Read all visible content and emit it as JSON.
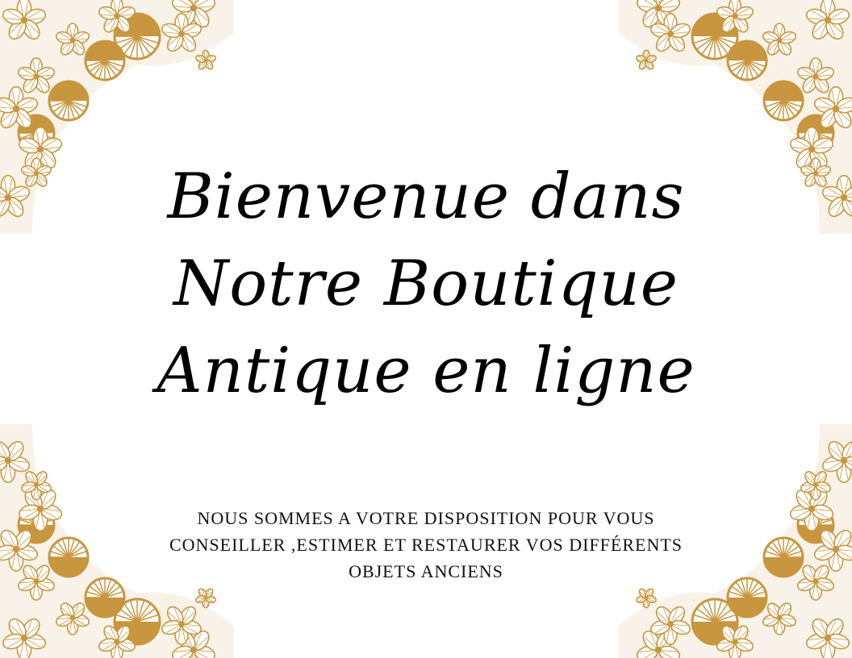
{
  "colors": {
    "lace": "#c8963e",
    "text": "#000000",
    "background": "#ffffff"
  },
  "title": {
    "lines": [
      "Bienvenue dans",
      "Notre Boutique",
      "Antique en ligne"
    ]
  },
  "subtitle": {
    "lines": [
      "NOUS SOMMES A VOTRE DISPOSITION POUR VOUS",
      "CONSEILLER ,ESTIMER ET RESTAURER VOS DIFFÉRENTS",
      "OBJETS ANCIENS"
    ]
  }
}
